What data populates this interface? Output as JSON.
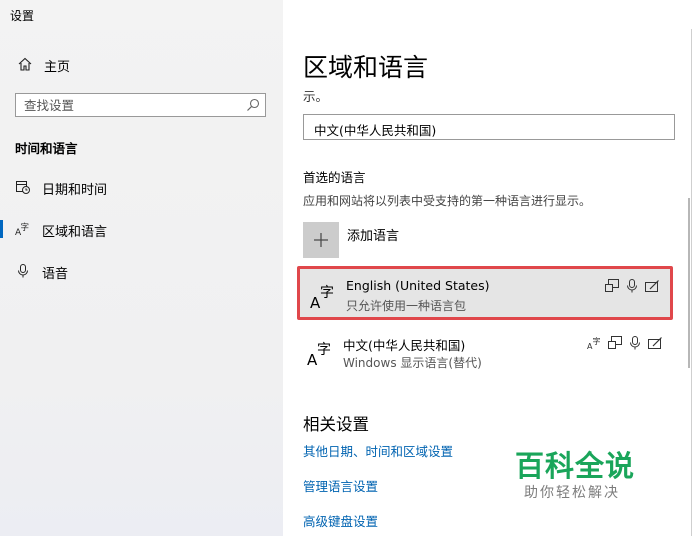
{
  "window": {
    "title": "设置"
  },
  "titlebar": {
    "minimize": "minimize",
    "maximize": "maximize",
    "close": "close"
  },
  "sidebar": {
    "home": {
      "label": "主页",
      "icon": "home-icon"
    },
    "search": {
      "placeholder": "查找设置",
      "icon": "search-icon"
    },
    "section": "时间和语言",
    "items": [
      {
        "label": "日期和时间",
        "icon": "calendar-clock-icon",
        "active": false
      },
      {
        "label": "区域和语言",
        "icon": "language-icon",
        "active": true
      },
      {
        "label": "语音",
        "icon": "microphone-icon",
        "active": false
      }
    ]
  },
  "main": {
    "title": "区域和语言",
    "cut_text": "示。",
    "display_language_value": "中文(中华人民共和国)",
    "preferred": {
      "heading": "首选的语言",
      "description": "应用和网站将以列表中受支持的第一种语言进行显示。",
      "add_label": "添加语言",
      "languages": [
        {
          "name": "English (United States)",
          "detail": "只允许使用一种语言包",
          "selected": true
        },
        {
          "name": "中文(中华人民共和国)",
          "detail": "Windows 显示语言(替代)",
          "selected": false
        }
      ]
    },
    "related": {
      "heading": "相关设置",
      "links": [
        "其他日期、时间和区域设置",
        "管理语言设置",
        "高级键盘设置"
      ]
    }
  },
  "watermark": {
    "title": "百科全说",
    "subtitle": "助你轻松解决"
  },
  "colors": {
    "accent": "#0078d7",
    "link": "#0063b1",
    "highlight_border": "#e0474b",
    "watermark": "#1aa55a"
  }
}
